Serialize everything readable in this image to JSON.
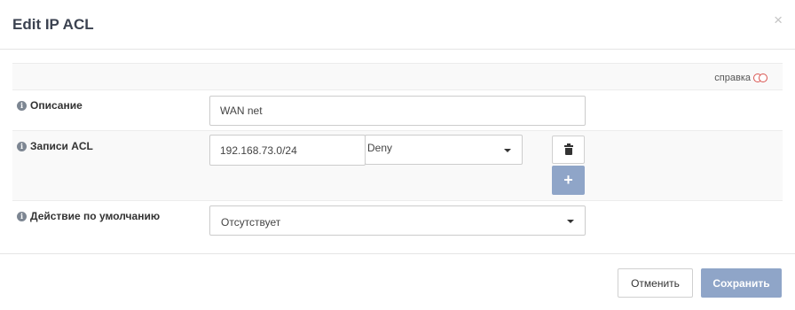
{
  "dialog": {
    "title": "Edit IP ACL",
    "close_glyph": "×"
  },
  "help": {
    "label": "справка",
    "icon": "toggle-icon",
    "icon_color": "#d9534f"
  },
  "fields": {
    "description": {
      "label": "Описание",
      "value": "WAN net"
    },
    "acl_entries": {
      "label": "Записи ACL",
      "entries": [
        {
          "network": "192.168.73.0/24",
          "action": "Deny"
        }
      ],
      "delete_icon": "trash-icon",
      "add_glyph": "+"
    },
    "default_action": {
      "label": "Действие по умолчанию",
      "value": "Отсутствует"
    }
  },
  "footer": {
    "cancel_label": "Отменить",
    "save_label": "Сохранить"
  },
  "colors": {
    "primary_button": "#8fa5c8",
    "info_icon": "#7d8692"
  }
}
